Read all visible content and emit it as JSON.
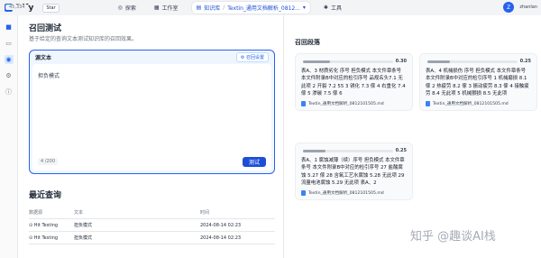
{
  "app": {
    "name": "Dify"
  },
  "header": {
    "github_label": "Star",
    "github_count": "45,334",
    "nav": {
      "explore": "探索",
      "studio": "工作室",
      "knowledge": "知识库",
      "dataset_name": "Textin_通用文档解析_0812...",
      "tools": "工具"
    },
    "user": {
      "initial": "Z",
      "name": "zhanlan"
    }
  },
  "left": {
    "title": "召回测试",
    "subtitle": "基于给定的查询文本测试知识库的召回效果。",
    "source_label": "源文本",
    "setting_button": "召回设置",
    "query_text": "担负模式",
    "char_count": "4 /200",
    "test_button": "测试"
  },
  "recent": {
    "title": "最近查询",
    "headers": [
      "数据源",
      "文本",
      "时间"
    ],
    "rows": [
      {
        "source": "Hit Testing",
        "text": "担负模式",
        "time": "2024-08-14 02:23"
      },
      {
        "source": "Hit Testing",
        "text": "担负模式",
        "time": "2024-08-14 02:23"
      }
    ]
  },
  "results": {
    "title": "召回段落",
    "segments": [
      {
        "score": "0.30",
        "score_value": 0.3,
        "text": "表A、3 材质劣化 序号 担负模式 本文件章条号 本文件附录B中对应的检引序号 品规名头7.1 无此项 2 开裂 7.2 55 3 锈化 7.3 傢 4 右重化 7.4 傢 5 渗碳 7.5 傢 6",
        "file": "Textin_通用文档解析_0812101505.md"
      },
      {
        "score": "0.25",
        "score_value": 0.25,
        "text": "表A、4 机械损伤 序号 担负模式 本文件章条号 本文件附录B中对应的检引序号 1 机械磨损 8.1 傢 2 热疲劳 8.2 傢 3 振动疲劳 8.3 傢 4 接触疲劳 8.4 无此项 5 机械颤损 8.5 无此项",
        "file": "Textin_通用文档解析_0812101505.md"
      },
      {
        "score": "0.25",
        "score_value": 0.25,
        "text": "表A、1 腐蚀减薄（续）序号 担负模式 本文件章条号 本文件附录B中对应的检引序号 27 盐酸腐蚀 5.27 傢 28 含氧工艺水腐蚀 5.28 无此项 29 流量电池腐蚀 5.29 无此项 表A、2",
        "file": "Textin_通用文档解析_0812101505.md"
      }
    ]
  },
  "watermark": "知乎 @趣谈AI栈"
}
